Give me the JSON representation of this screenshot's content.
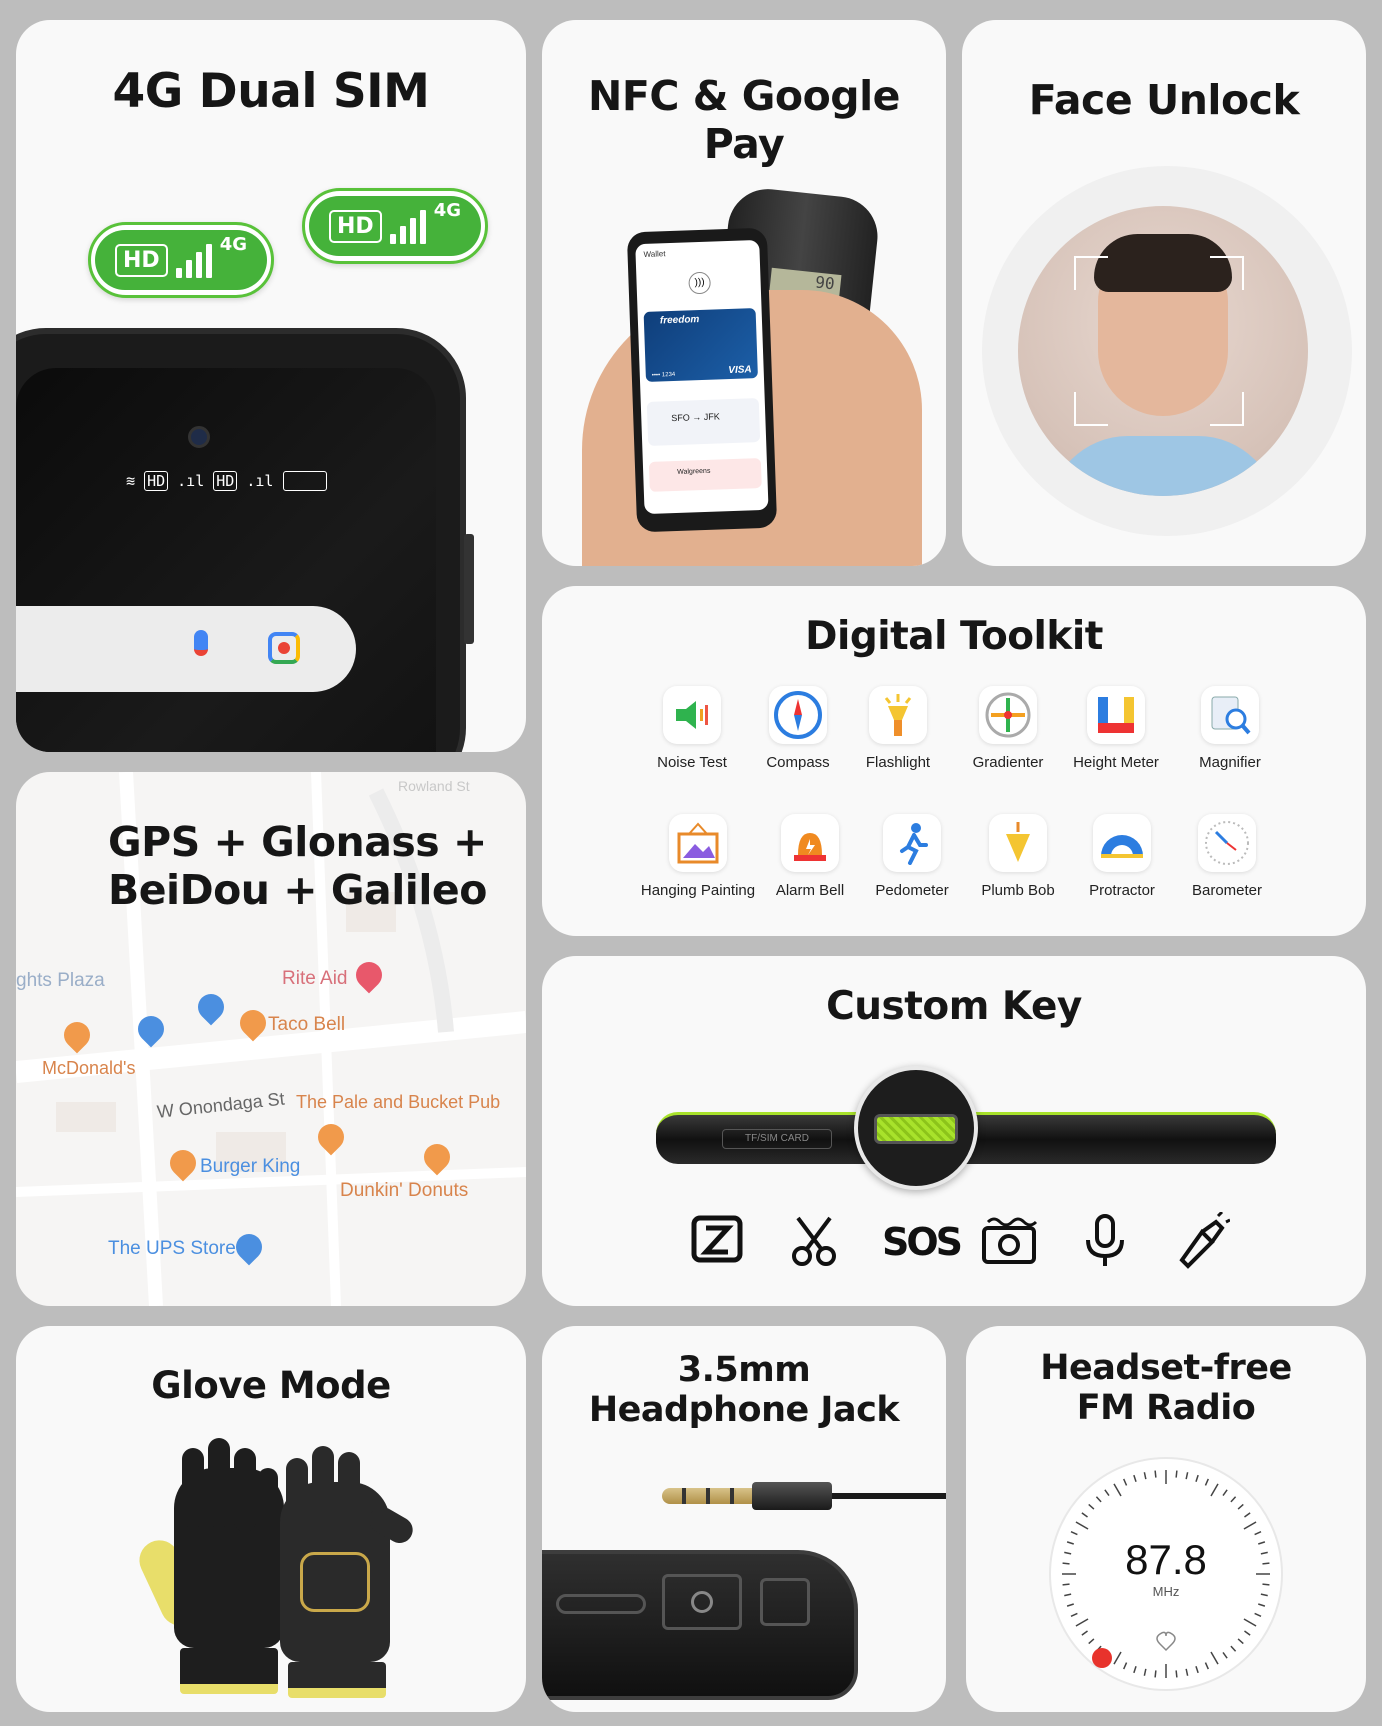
{
  "cards": {
    "dual_sim": {
      "title": "4G Dual SIM",
      "badge_hd": "HD",
      "badge_net": "4G"
    },
    "nfc": {
      "title": "NFC & Google Pay",
      "phone": {
        "app": "Wallet",
        "card_brand": "freedom",
        "card_network": "VISA",
        "card_number": "•••• 1234",
        "flight": "SFO → JFK",
        "store": "Walgreens",
        "terminal_display": "90"
      }
    },
    "face": {
      "title": "Face Unlock"
    },
    "gps": {
      "title_line1": "GPS + Glonass +",
      "title_line2": "BeiDou + Galileo",
      "map_labels": {
        "rowland": "Rowland St",
        "heights": "ghts Plaza",
        "rite_aid": "Rite Aid",
        "taco_bell": "Taco Bell",
        "mcdonalds": "McDonald's",
        "onondaga": "W Onondaga St",
        "pale": "The Pale and Bucket Pub",
        "burger_king": "Burger King",
        "dunkin": "Dunkin' Donuts",
        "ups": "The UPS Store"
      }
    },
    "toolkit": {
      "title": "Digital Toolkit",
      "items": [
        {
          "label": "Noise Test",
          "icon": "speaker-icon"
        },
        {
          "label": "Compass",
          "icon": "compass-icon"
        },
        {
          "label": "Flashlight",
          "icon": "flashlight-icon"
        },
        {
          "label": "Gradienter",
          "icon": "level-icon"
        },
        {
          "label": "Height Meter",
          "icon": "ruler-icon"
        },
        {
          "label": "Magnifier",
          "icon": "magnifier-icon"
        },
        {
          "label": "Hanging Painting",
          "icon": "picture-icon"
        },
        {
          "label": "Alarm Bell",
          "icon": "alarm-icon"
        },
        {
          "label": "Pedometer",
          "icon": "walker-icon"
        },
        {
          "label": "Plumb Bob",
          "icon": "plumb-icon"
        },
        {
          "label": "Protractor",
          "icon": "protractor-icon"
        },
        {
          "label": "Barometer",
          "icon": "gauge-icon"
        }
      ]
    },
    "custom_key": {
      "title": "Custom Key",
      "slot_label": "TF/SIM CARD",
      "sos_label": "SOS",
      "icons": [
        "z-app-icon",
        "scissors-icon",
        "sos-icon",
        "camera-icon",
        "microphone-icon",
        "flashlight-icon"
      ]
    },
    "glove": {
      "title": "Glove Mode"
    },
    "jack": {
      "title_line1": "3.5mm",
      "title_line2": "Headphone Jack"
    },
    "radio": {
      "title_line1": "Headset-free",
      "title_line2": "FM Radio",
      "frequency": "87.8",
      "unit": "MHz"
    }
  },
  "colors": {
    "accent_green": "#45b23a",
    "key_green": "#a8e22b",
    "background": "#bdbdbd"
  }
}
